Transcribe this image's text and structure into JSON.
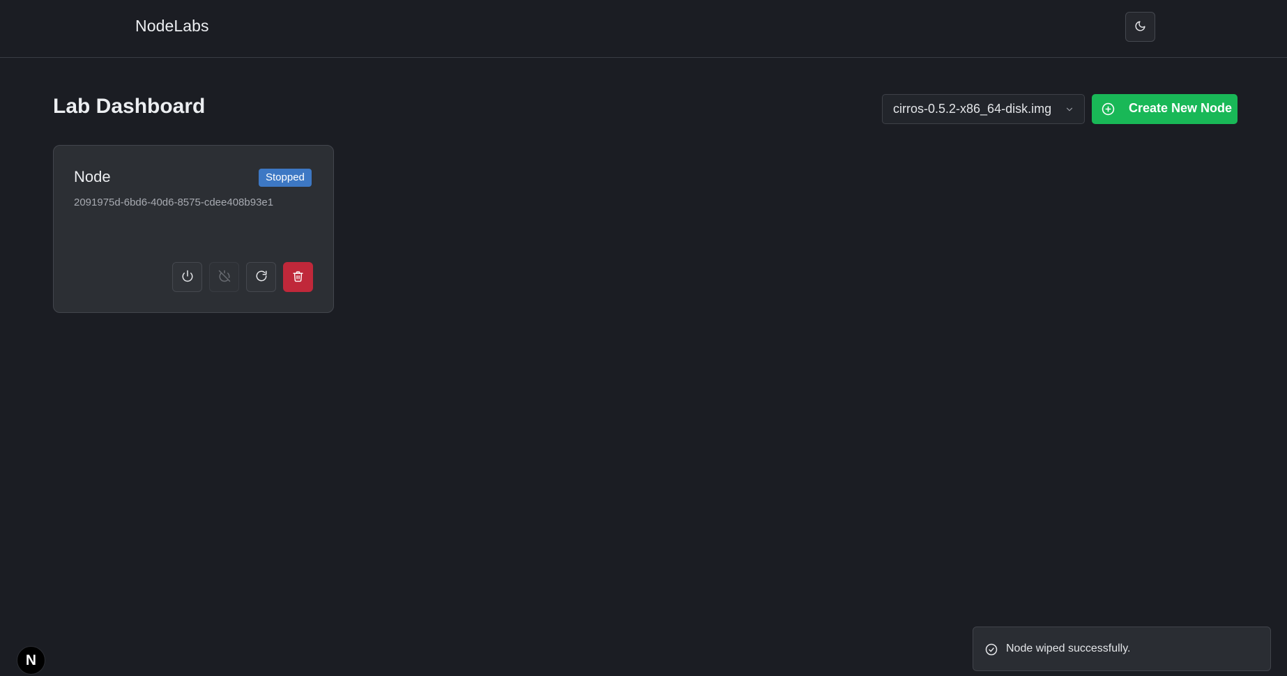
{
  "header": {
    "brand": "NodeLabs",
    "theme_toggle_icon": "moon-icon"
  },
  "main": {
    "title": "Lab Dashboard",
    "image_select": {
      "selected": "cirros-0.5.2-x86_64-disk.img",
      "icon": "chevron-down-icon"
    },
    "create_button": {
      "label": "Create New Node",
      "icon": "plus-circle-icon"
    }
  },
  "nodes": [
    {
      "name": "Node",
      "status": "Stopped",
      "id": "2091975d-6bd6-40d6-8575-cdee408b93e1",
      "actions": [
        {
          "name": "start",
          "icon": "power-icon",
          "disabled": false
        },
        {
          "name": "stop",
          "icon": "power-off-icon",
          "disabled": true
        },
        {
          "name": "wipe",
          "icon": "refresh-icon",
          "disabled": false
        },
        {
          "name": "delete",
          "icon": "trash-icon",
          "disabled": false
        }
      ]
    }
  ],
  "toast": {
    "message": "Node wiped successfully.",
    "icon": "check-circle-icon"
  },
  "colors": {
    "background": "#1b1d23",
    "accent_green": "#19b857",
    "status_stopped": "#3d78c4",
    "danger": "#c0283a"
  },
  "dev_badge": {
    "label": "N"
  }
}
